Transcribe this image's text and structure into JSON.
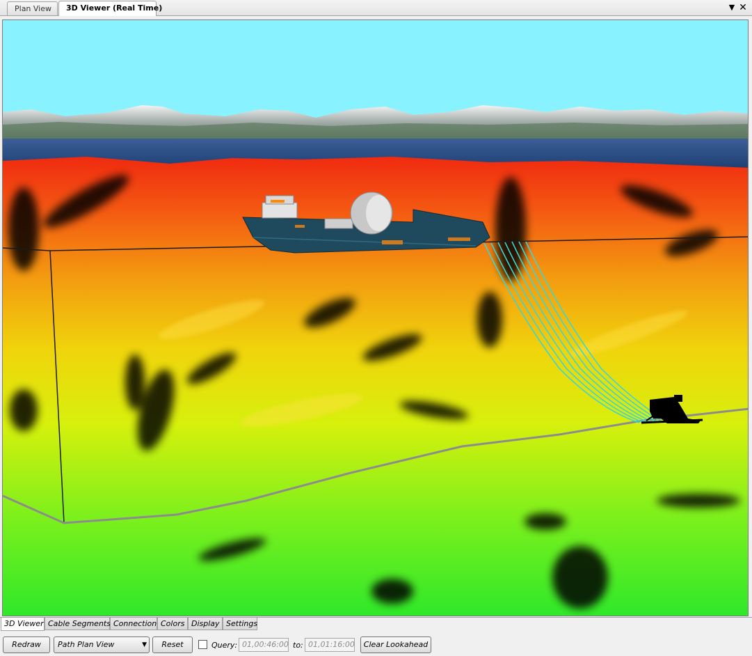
{
  "top_tabs": [
    {
      "label": "Plan View",
      "active": false
    },
    {
      "label": "3D Viewer (Real Time)",
      "active": true
    }
  ],
  "window_controls": {
    "dropdown_icon": "dropdown-arrow-icon",
    "close_icon": "close-icon"
  },
  "viewport": {
    "sky_color": "#88f3ff",
    "water_color": "#1e3f78",
    "vessel_hull_color": "#1f4a5e",
    "cable_color": "#3ad6d6"
  },
  "bottom_tabs": [
    {
      "label": "3D Viewer",
      "active": true
    },
    {
      "label": "Cable Segments",
      "active": false
    },
    {
      "label": "Connection",
      "active": false
    },
    {
      "label": "Colors",
      "active": false
    },
    {
      "label": "Display",
      "active": false
    },
    {
      "label": "Settings",
      "active": false
    }
  ],
  "toolbar": {
    "redraw_label": "Redraw",
    "view_select_value": "Path Plan View",
    "reset_label": "Reset",
    "query_label": "Query:",
    "query_checked": false,
    "from_value": "01,00:46:00",
    "to_label": "to:",
    "to_value": "01,01:16:00",
    "clear_lookahead_label": "Clear Lookahead"
  }
}
